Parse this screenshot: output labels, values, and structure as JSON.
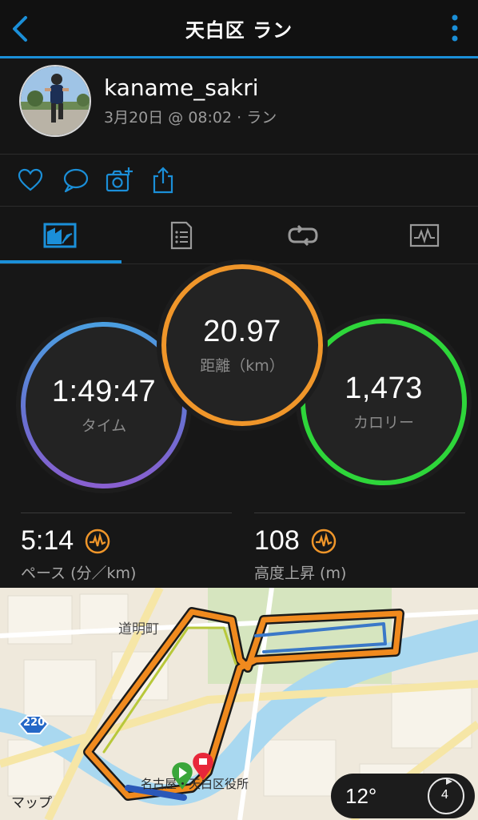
{
  "header": {
    "title": "天白区 ラン",
    "back_icon": "chevron-left-icon",
    "more_icon": "vertical-dots-icon"
  },
  "profile": {
    "username": "kaname_sakri",
    "subline": "3月20日 @ 08:02 · ラン"
  },
  "actions": [
    "heart-icon",
    "comment-icon",
    "add-photo-icon",
    "share-icon"
  ],
  "tabs": [
    {
      "icon": "overview-chart-icon",
      "active": true
    },
    {
      "icon": "details-list-icon",
      "active": false
    },
    {
      "icon": "laps-loop-icon",
      "active": false
    },
    {
      "icon": "stats-graph-icon",
      "active": false
    }
  ],
  "stats": {
    "time": {
      "value": "1:49:47",
      "label": "タイム"
    },
    "distance": {
      "value": "20.97",
      "label": "距離（km）"
    },
    "calories": {
      "value": "1,473",
      "label": "カロリー"
    }
  },
  "metrics": {
    "pace": {
      "value": "5:14",
      "label": "ペース (分／km)"
    },
    "elevation": {
      "value": "108",
      "label": "高度上昇 (m)"
    }
  },
  "map": {
    "district_label": "道明町",
    "route_shield": "220",
    "place_label": "名古屋・天白区役所",
    "attribution": "マップ"
  },
  "weather": {
    "temp": "12°",
    "wind": "4"
  },
  "colors": {
    "accent": "#1b8fd8",
    "time_ring": "#4a9fe0",
    "distance_ring": "#f0962a",
    "calories_ring": "#2ed63a",
    "metric_icon": "#f0962a"
  }
}
